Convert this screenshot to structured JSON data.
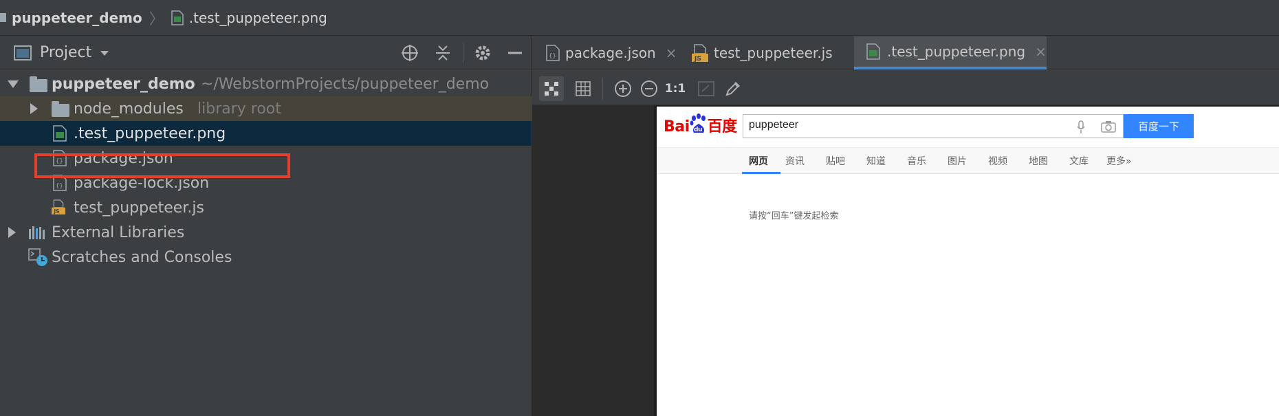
{
  "breadcrumb": {
    "project": "puppeteer_demo",
    "file": ".test_puppeteer.png"
  },
  "project_panel": {
    "title": "Project",
    "header_icons": [
      "locate-icon",
      "collapse-all-icon",
      "gear-icon",
      "hide-icon"
    ]
  },
  "tree": {
    "root_name": "puppeteer_demo",
    "root_path": "~/WebstormProjects/puppeteer_demo",
    "node_modules_name": "node_modules",
    "node_modules_hint": "library root",
    "files": [
      ".test_puppeteer.png",
      "package.json",
      "package-lock.json",
      "test_puppeteer.js"
    ],
    "external_libraries": "External Libraries",
    "scratches": "Scratches and Consoles"
  },
  "tabs": [
    {
      "label": "package.json",
      "close": "×"
    },
    {
      "label": "test_puppeteer.js",
      "close": "×"
    },
    {
      "label": ".test_puppeteer.png",
      "close": "×"
    }
  ],
  "image_toolbar": {
    "zoom_actual_label": "1:1"
  },
  "preview": {
    "logo_red1": "Bai",
    "logo_blue": "du",
    "logo_red2": "百度",
    "search_value": "puppeteer",
    "search_button": "百度一下",
    "nav_tabs": [
      "网页",
      "资讯",
      "贴吧",
      "知道",
      "音乐",
      "图片",
      "视频",
      "地图",
      "文库",
      "更多»"
    ],
    "hint": "请按“回车”键发起检索"
  },
  "colors": {
    "accent_blue": "#4a88c7",
    "selection_bg": "#0d293e",
    "highlight_red": "#e2402b",
    "baidu_blue": "#3385ff",
    "baidu_red": "#e10602"
  }
}
